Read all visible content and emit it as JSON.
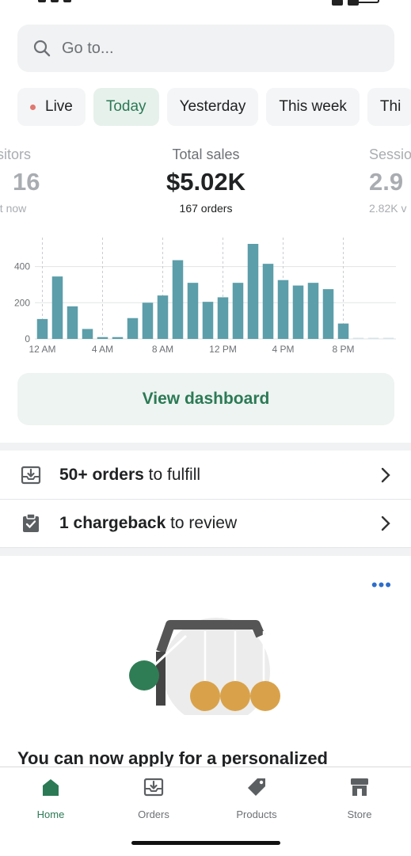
{
  "search": {
    "placeholder": "Go to..."
  },
  "filters": [
    {
      "label": "Live",
      "state": "live-dot"
    },
    {
      "label": "Today",
      "state": "selected"
    },
    {
      "label": "Yesterday"
    },
    {
      "label": "This week"
    },
    {
      "label": "Thi"
    }
  ],
  "metrics": {
    "left": {
      "label": "isitors",
      "value": "16",
      "sub": "ht now"
    },
    "center": {
      "label": "Total sales",
      "value": "$5.02K",
      "sub": "167 orders"
    },
    "right": {
      "label": "Sessio",
      "value": "2.9",
      "sub": "2.82K v"
    }
  },
  "chart_data": {
    "type": "bar",
    "title": "",
    "xlabel": "",
    "ylabel": "",
    "ylim": [
      0,
      560
    ],
    "y_ticks": [
      "0",
      "200",
      "400"
    ],
    "x_ticks": [
      "12 AM",
      "4 AM",
      "8 AM",
      "12 PM",
      "4 PM",
      "8 PM"
    ],
    "categories": [
      "12 AM",
      "1 AM",
      "2 AM",
      "3 AM",
      "4 AM",
      "5 AM",
      "6 AM",
      "7 AM",
      "8 AM",
      "9 AM",
      "10 AM",
      "11 AM",
      "12 PM",
      "1 PM",
      "2 PM",
      "3 PM",
      "4 PM",
      "5 PM",
      "6 PM",
      "7 PM",
      "8 PM",
      "9 PM",
      "10 PM",
      "11 PM"
    ],
    "values": [
      110,
      345,
      180,
      55,
      10,
      10,
      115,
      200,
      240,
      435,
      310,
      205,
      230,
      310,
      525,
      415,
      325,
      295,
      310,
      275,
      85,
      5,
      5,
      5
    ],
    "color": "#5c9eaa",
    "future_color": "#d4e5e8",
    "grid": true
  },
  "actions": {
    "view_dashboard": "View dashboard"
  },
  "tasks": [
    {
      "bold": "50+ orders",
      "rest": " to fulfill",
      "icon": "inbox-icon"
    },
    {
      "bold": "1 chargeback",
      "rest": " to review",
      "icon": "clipboard-check-icon"
    }
  ],
  "promo": {
    "text": "You can now apply for a personalized"
  },
  "tabs": [
    {
      "label": "Home",
      "icon": "home-icon",
      "active": true
    },
    {
      "label": "Orders",
      "icon": "orders-icon"
    },
    {
      "label": "Products",
      "icon": "tag-icon"
    },
    {
      "label": "Store",
      "icon": "store-icon"
    }
  ],
  "colors": {
    "accent": "#2b7a55",
    "bar": "#5c9eaa",
    "link": "#2c6ecb"
  }
}
